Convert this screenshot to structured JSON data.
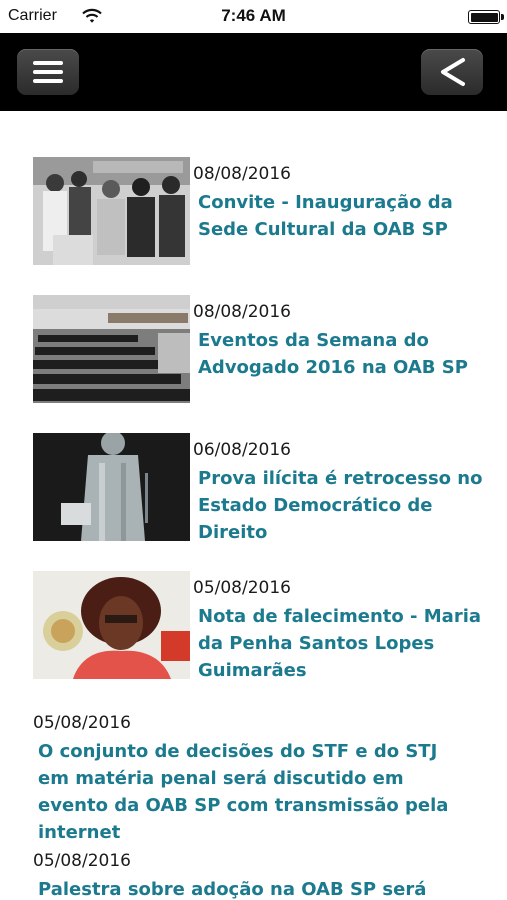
{
  "status_bar": {
    "carrier": "Carrier",
    "time": "7:46 AM"
  },
  "news": [
    {
      "date": "08/08/2016",
      "title": "Convite - Inauguração da Sede Cultural da OAB SP",
      "thumb": "photo-ceremony"
    },
    {
      "date": "08/08/2016",
      "title": "Eventos da Semana do Advogado 2016 na OAB SP",
      "thumb": "photo-auditorium"
    },
    {
      "date": "06/08/2016",
      "title": "Prova ilícita é retrocesso no Estado Democrático de Direito",
      "thumb": "photo-statue"
    },
    {
      "date": "05/08/2016",
      "title": "Nota de falecimento - Maria da Penha Santos Lopes Guimarães",
      "thumb": "photo-portrait"
    },
    {
      "date": "05/08/2016",
      "title": "O conjunto de decisões do STF e do STJ em matéria penal será discutido em evento da OAB SP com transmissão pela internet"
    },
    {
      "date": "05/08/2016",
      "title": "Palestra sobre adoção na OAB SP será"
    }
  ]
}
